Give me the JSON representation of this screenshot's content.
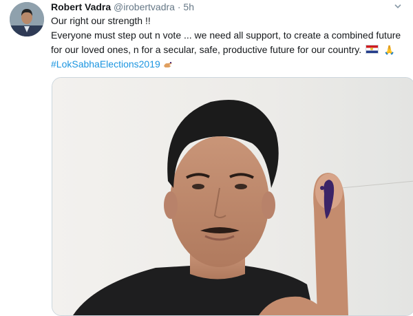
{
  "tweet": {
    "author_name": "Robert Vadra",
    "handle": "@irobertvadra",
    "separator": "·",
    "time": "5h",
    "caret_icon": "chevron-down-icon",
    "line1": "Our right our strength !!",
    "line2": "Everyone must step out n vote ... we need all support, to create a combined future for our loved ones, n for a secular, safe, productive future for our country.",
    "hashtag": "#LokSabhaElections2019",
    "emojis": [
      "flag-icon",
      "folded-hands-icon",
      "voting-hand-icon"
    ]
  },
  "colors": {
    "link": "#1b95e0",
    "text": "#14171a",
    "muted": "#657786",
    "border": "#ccd6dd"
  }
}
